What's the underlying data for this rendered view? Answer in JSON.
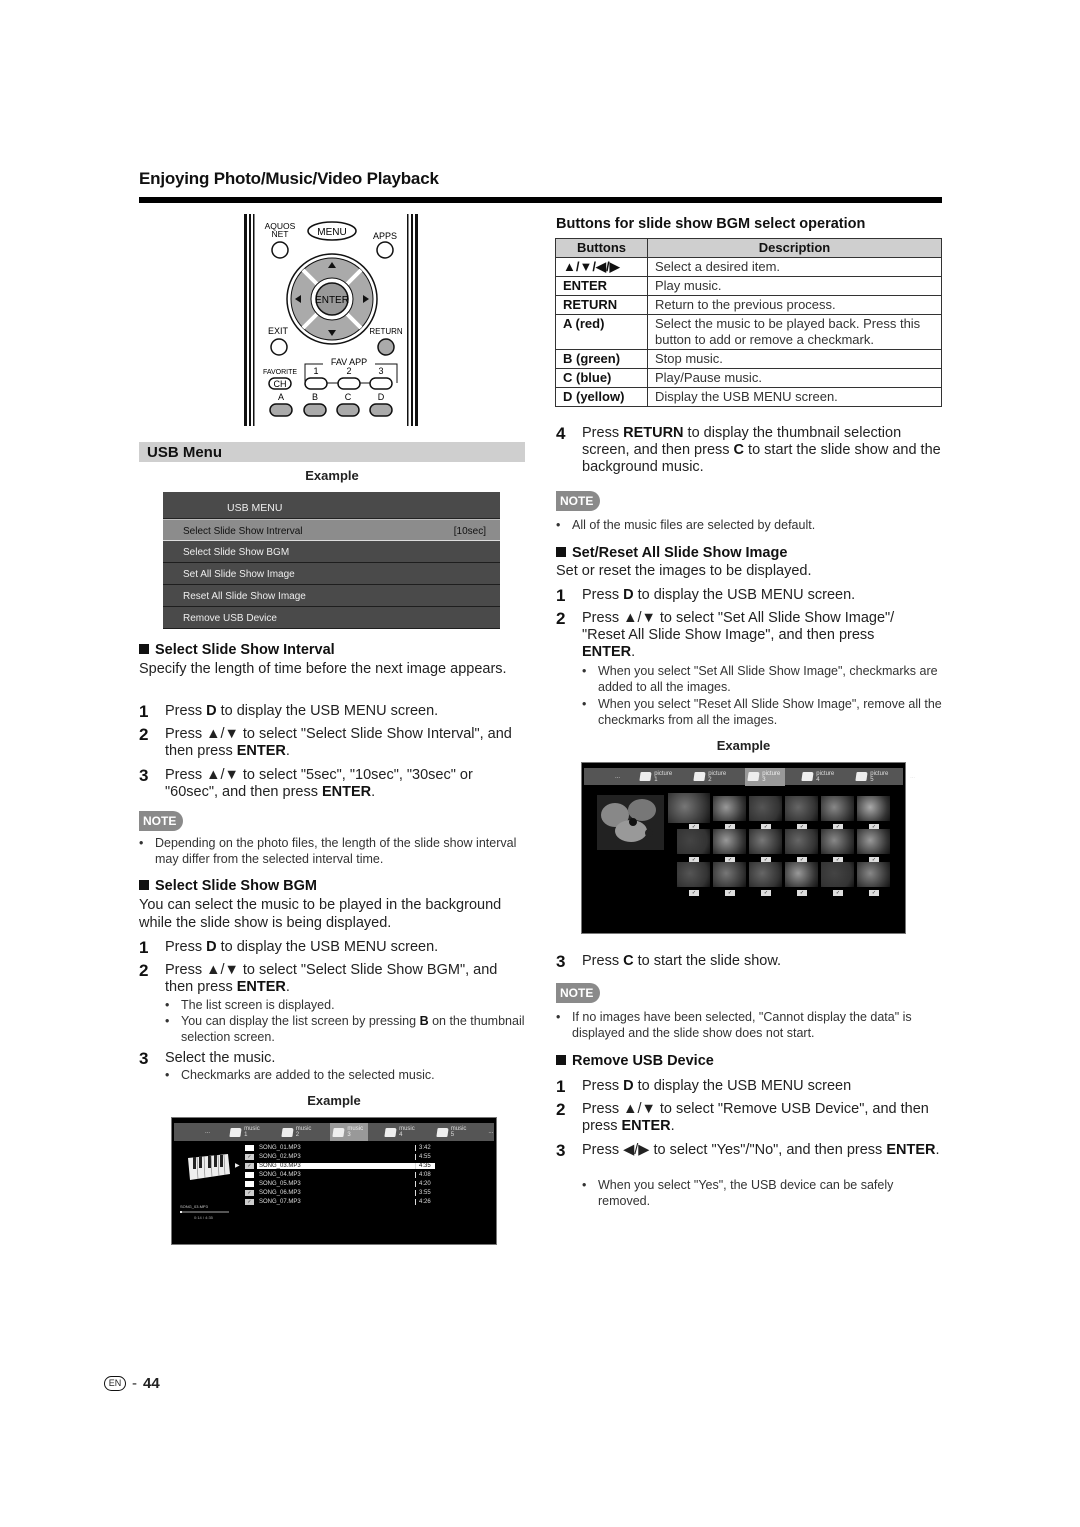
{
  "page": {
    "title": "Enjoying Photo/Music/Video Playback",
    "page_number": "44",
    "language_badge": "EN"
  },
  "remote": {
    "labels": {
      "aquos_net": "AQUOS NET",
      "menu": "MENU",
      "apps": "APPS",
      "enter": "ENTER",
      "exit": "EXIT",
      "return": "RETURN",
      "favorite": "FAVORITE",
      "ch": "CH",
      "fav_app": "FAV APP",
      "fav1": "1",
      "fav2": "2",
      "fav3": "3",
      "a": "A",
      "b": "B",
      "c": "C",
      "d": "D"
    }
  },
  "usb_menu_section": {
    "heading": "USB Menu",
    "example_label": "Example",
    "menu": {
      "title": "USB MENU",
      "items": [
        {
          "label": "Select Slide Show Intrerval",
          "value": "[10sec]",
          "selected": true
        },
        {
          "label": "Select Slide Show BGM",
          "value": "",
          "selected": false
        },
        {
          "label": "Set All Slide Show Image",
          "value": "",
          "selected": false
        },
        {
          "label": "Reset All Slide Show Image",
          "value": "",
          "selected": false
        },
        {
          "label": "Remove USB Device",
          "value": "",
          "selected": false
        }
      ]
    }
  },
  "interval": {
    "heading": "Select Slide Show Interval",
    "intro": "Specify the length of time before the next image appears.",
    "steps": [
      {
        "num": "1",
        "pre": "Press ",
        "bold": "D",
        "post": " to display the USB MENU screen."
      },
      {
        "num": "2",
        "pre": "Press ▲/▼ to select \"Select Slide Show Interval\", and then press ",
        "bold": "ENTER",
        "post": "."
      },
      {
        "num": "3",
        "pre": "Press ▲/▼ to select \"5sec\", \"10sec\", \"30sec\" or \"60sec\", and then press ",
        "bold": "ENTER",
        "post": "."
      }
    ],
    "note_label": "NOTE",
    "note": "Depending on the photo files, the length of the slide show interval may differ from the selected interval time."
  },
  "bgm": {
    "heading": "Select Slide Show BGM",
    "intro": "You can select the music to be played in the background while the slide show is being displayed.",
    "step1": {
      "num": "1",
      "pre": "Press ",
      "bold": "D",
      "post": " to display the USB MENU screen."
    },
    "step2": {
      "num": "2",
      "pre": "Press ▲/▼ to  select \"Select Slide Show BGM\", and then press ",
      "bold": "ENTER",
      "post": "."
    },
    "step2_bullets": [
      "The list screen is displayed.",
      {
        "pre": "You can display the list screen by pressing ",
        "bold": "B",
        "post": " on the thumbnail selection screen."
      }
    ],
    "step3": {
      "num": "3",
      "text": "Select the music."
    },
    "step3_bullet": "Checkmarks are added to the selected music.",
    "example_label": "Example",
    "screen": {
      "tabs": [
        {
          "label": "...",
          "folder": false,
          "selected": false
        },
        {
          "label": "music 1",
          "folder": true,
          "selected": false
        },
        {
          "label": "music 2",
          "folder": true,
          "selected": false
        },
        {
          "label": "music 3",
          "folder": true,
          "selected": true
        },
        {
          "label": "music 4",
          "folder": true,
          "selected": false
        },
        {
          "label": "music 5",
          "folder": true,
          "selected": false
        },
        {
          "label": "...",
          "folder": false,
          "selected": false
        }
      ],
      "now_playing": "SONG_03.MP3",
      "elapsed": "0:14 / 4:35",
      "progress": 0.05,
      "songs": [
        {
          "name": "SONG_01.MP3",
          "time": "3:42",
          "checked": false,
          "selected": false
        },
        {
          "name": "SONG_02.MP3",
          "time": "4:55",
          "checked": true,
          "selected": false
        },
        {
          "name": "SONG_03.MP3",
          "time": "4:35",
          "checked": true,
          "selected": true
        },
        {
          "name": "SONG_04.MP3",
          "time": "4:08",
          "checked": false,
          "selected": false
        },
        {
          "name": "SONG_05.MP3",
          "time": "4:20",
          "checked": false,
          "selected": false
        },
        {
          "name": "SONG_06.MP3",
          "time": "3:55",
          "checked": true,
          "selected": false
        },
        {
          "name": "SONG_07.MP3",
          "time": "4:26",
          "checked": true,
          "selected": false
        }
      ],
      "check_glyph": "✓",
      "cursor_glyph": "▶"
    }
  },
  "buttons_table": {
    "heading": "Buttons for slide show BGM select operation",
    "columns": [
      "Buttons",
      "Description"
    ],
    "rows": [
      {
        "button": "▲/▼/◀/▶",
        "description": "Select a desired item."
      },
      {
        "button": "ENTER",
        "description": "Play music."
      },
      {
        "button": "RETURN",
        "description": "Return to the previous process."
      },
      {
        "button": "A (red)",
        "description": "Select the music to be played back. Press this button to add or remove a checkmark."
      },
      {
        "button": "B (green)",
        "description": "Stop music."
      },
      {
        "button": "C (blue)",
        "description": "Play/Pause music."
      },
      {
        "button": "D (yellow)",
        "description": "Display the USB MENU screen."
      }
    ]
  },
  "bgm_step4": {
    "num": "4",
    "pre": "Press ",
    "bold1": "RETURN",
    "mid": " to display the thumbnail selection screen, and then press ",
    "bold2": "C",
    "post": " to start the slide show and the background music."
  },
  "bgm_note": {
    "label": "NOTE",
    "text": "All of the music files are selected by default."
  },
  "set_reset": {
    "heading": "Set/Reset All Slide Show Image",
    "intro": "Set or reset the images to be displayed.",
    "step1": {
      "num": "1",
      "pre": "Press ",
      "bold": "D",
      "post": " to display the USB MENU screen."
    },
    "step2": {
      "num": "2",
      "pre": "Press ▲/▼ to select \"Set All Slide Show Image\"/ \"Reset All Slide Show Image\", and then press ",
      "bold": "ENTER",
      "post": "."
    },
    "bullets": [
      "When you select \"Set All Slide Show Image\", checkmarks are added to all the images.",
      "When you select \"Reset All Slide Show Image\", remove all the checkmarks from all the images."
    ],
    "example_label": "Example",
    "screen": {
      "tabs": [
        {
          "label": "...",
          "folder": false,
          "selected": false
        },
        {
          "label": "picture 1",
          "folder": true,
          "selected": false
        },
        {
          "label": "picture 2",
          "folder": true,
          "selected": false
        },
        {
          "label": "picture 3",
          "folder": true,
          "selected": true
        },
        {
          "label": "picture 4",
          "folder": true,
          "selected": false
        },
        {
          "label": "picture 5",
          "folder": true,
          "selected": false
        },
        {
          "label": "...",
          "folder": false,
          "selected": false
        }
      ],
      "thumbnail_rows": 3,
      "thumbnail_cols": 6,
      "all_checked": true
    },
    "step3": {
      "num": "3",
      "pre": "Press ",
      "bold": "C",
      "post": " to start the slide show."
    },
    "note_label": "NOTE",
    "note": "If no images have been selected, \"Cannot display the data\" is displayed and the slide show does not start."
  },
  "remove_usb": {
    "heading": "Remove USB Device",
    "step1": {
      "num": "1",
      "pre": "Press ",
      "bold": "D",
      "post": " to display the USB MENU screen"
    },
    "step2": {
      "num": "2",
      "pre": "Press ▲/▼ to select \"Remove USB Device\", and then press ",
      "bold": "ENTER",
      "post": "."
    },
    "step3": {
      "num": "3",
      "pre": "Press ◀/▶ to select \"Yes\"/\"No\", and then press ",
      "bold": "ENTER",
      "post": "."
    },
    "bullet": "When you select \"Yes\", the USB device can be safely removed."
  }
}
